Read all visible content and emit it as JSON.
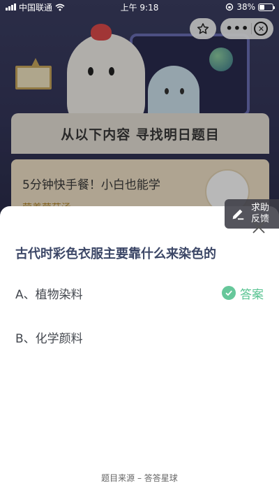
{
  "status_bar": {
    "carrier": "中国联通",
    "time": "上午 9:18",
    "battery_percent": "38%",
    "battery_level": 0.38
  },
  "top_controls": {
    "favorite_icon": "star-outline-icon",
    "more_icon": "more-dots-icon",
    "close_icon": "close-circle-icon"
  },
  "background": {
    "banner_text": "从以下内容 寻找明日题目",
    "card_title": "5分钟快手餐！小白也能学",
    "card_subtitle": "营养菌菇汤"
  },
  "help": {
    "label_line1": "求助",
    "label_line2": "反馈",
    "icon": "pencil-icon"
  },
  "quiz": {
    "question": "古代时彩色衣服主要靠什么来染色的",
    "options": [
      {
        "label": "A、植物染料",
        "is_answer": true
      },
      {
        "label": "B、化学颜料",
        "is_answer": false
      }
    ],
    "answer_tag": "答案",
    "source": "题目来源 – 答答星球"
  },
  "colors": {
    "accent_green": "#5ac493",
    "question_color": "#3b4666"
  }
}
